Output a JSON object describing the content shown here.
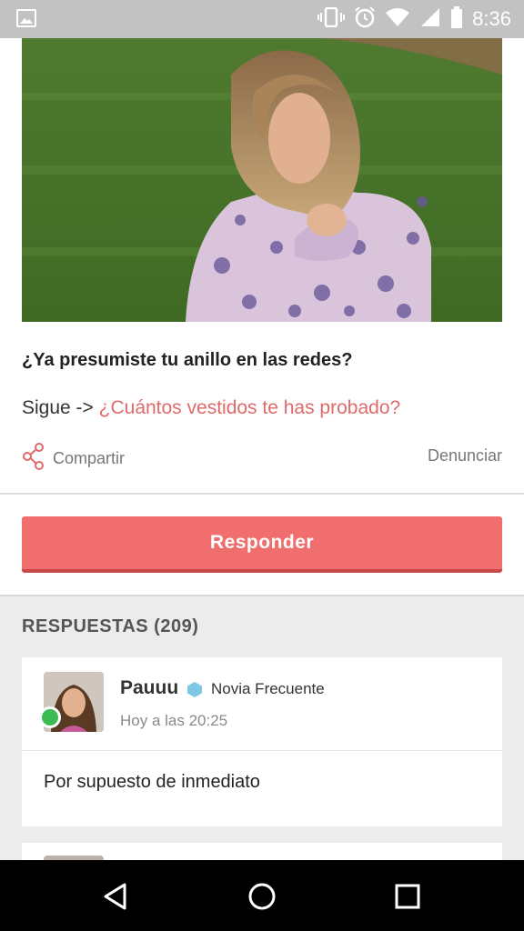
{
  "status_bar": {
    "time": "8:36",
    "icons": [
      "gallery-icon",
      "vibrate-icon",
      "alarm-icon",
      "wifi-icon",
      "signal-icon",
      "battery-icon"
    ]
  },
  "post": {
    "image_alt": "woman-in-floral-top-gif",
    "question": "¿Ya presumiste tu anillo en las redes?",
    "follow_prefix": "Sigue -> ",
    "follow_link": "¿Cuántos vestidos te has probado?",
    "share_label": "Compartir",
    "report_label": "Denunciar"
  },
  "reply_button_label": "Responder",
  "answers": {
    "heading": "RESPUESTAS (209)",
    "items": [
      {
        "author": "Pauuu",
        "badge": "Novia Frecuente",
        "timestamp": "Hoy a las 20:25",
        "text": "Por supuesto de inmediato",
        "online": true
      }
    ]
  },
  "colors": {
    "accent": "#f06e6e",
    "link": "#e06a6a",
    "online": "#3cba54",
    "badge": "#7ec8e3"
  }
}
